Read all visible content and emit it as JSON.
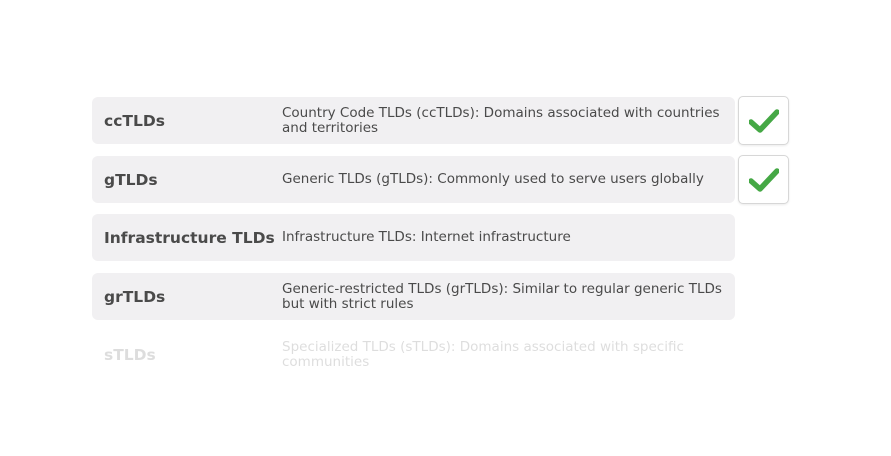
{
  "colors": {
    "row_bg": "#f1f0f2",
    "text": "#4a4a4a",
    "check": "#45a845"
  },
  "rows": [
    {
      "name": "ccTLDs",
      "description": "Country Code TLDs (ccTLDs): Domains associated with countries and territories",
      "checked": true
    },
    {
      "name": "gTLDs",
      "description": "Generic TLDs (gTLDs): Commonly used to serve users globally",
      "checked": true
    },
    {
      "name": "Infrastructure TLDs",
      "description": "Infrastructure TLDs: Internet infrastructure",
      "checked": false
    },
    {
      "name": "grTLDs",
      "description": "Generic-restricted TLDs (grTLDs): Similar to regular generic TLDs but with strict rules",
      "checked": false
    },
    {
      "name": "sTLDs",
      "description": "Specialized TLDs (sTLDs): Domains associated with specific communities",
      "checked": false
    }
  ],
  "check_icon": "check-icon"
}
